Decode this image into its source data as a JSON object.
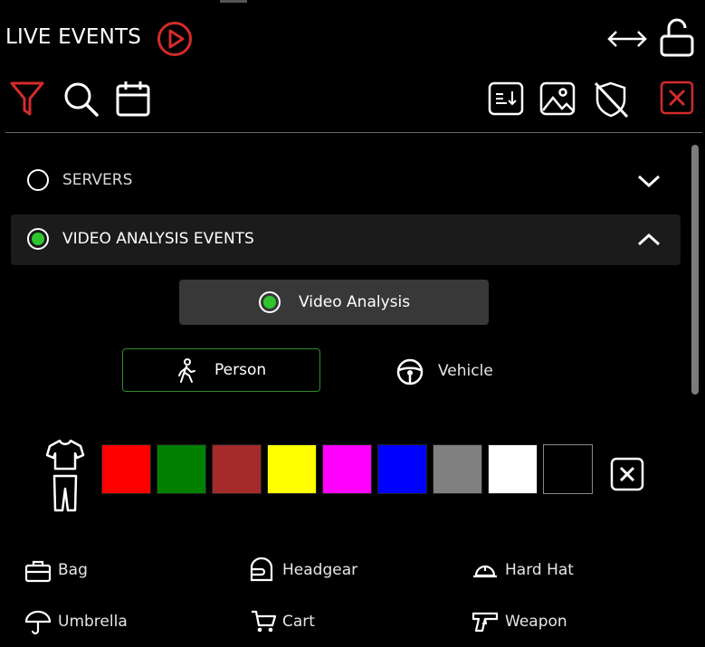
{
  "header": {
    "title": "LIVE EVENTS"
  },
  "accent": {
    "red": "#d42b2b",
    "green": "#2ec52e"
  },
  "sections": {
    "servers": {
      "label": "SERVERS",
      "selected": false,
      "expanded": false
    },
    "video_analysis_events": {
      "label": "VIDEO ANALYSIS EVENTS",
      "selected": true,
      "expanded": true
    }
  },
  "video_analysis": {
    "label": "Video Analysis",
    "selected": true
  },
  "object_types": [
    {
      "label": "Person",
      "icon": "person-walking-icon",
      "selected": true
    },
    {
      "label": "Vehicle",
      "icon": "steering-wheel-icon",
      "selected": false
    }
  ],
  "colors": [
    "#ff0000",
    "#008000",
    "#a52a2a",
    "#ffff00",
    "#ff00ff",
    "#0000ff",
    "#808080",
    "#ffffff",
    "#000000"
  ],
  "attributes": [
    {
      "label": "Bag",
      "icon": "bag-icon"
    },
    {
      "label": "Headgear",
      "icon": "headgear-icon"
    },
    {
      "label": "Hard Hat",
      "icon": "hard-hat-icon"
    },
    {
      "label": "Umbrella",
      "icon": "umbrella-icon"
    },
    {
      "label": "Cart",
      "icon": "cart-icon"
    },
    {
      "label": "Weapon",
      "icon": "weapon-icon"
    }
  ]
}
